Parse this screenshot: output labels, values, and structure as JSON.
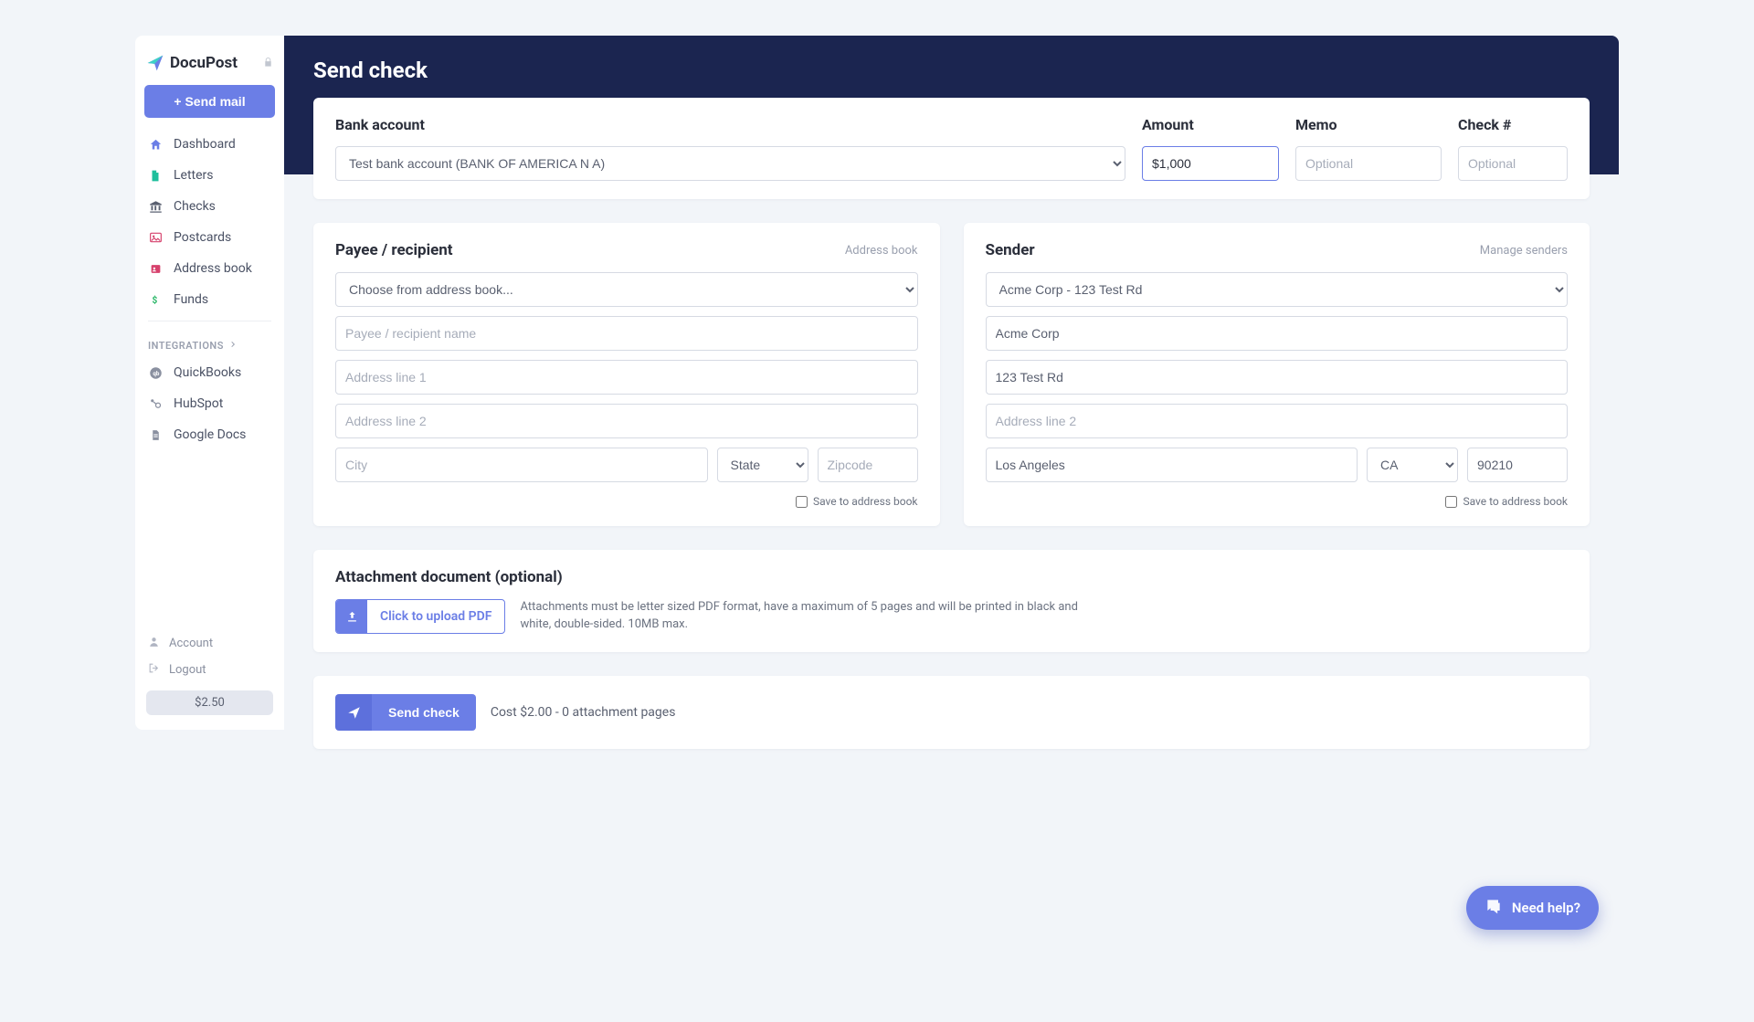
{
  "brand": {
    "name": "DocuPost"
  },
  "sidebar": {
    "send_mail_label": "+ Send mail",
    "items": [
      {
        "label": "Dashboard"
      },
      {
        "label": "Letters"
      },
      {
        "label": "Checks"
      },
      {
        "label": "Postcards"
      },
      {
        "label": "Address book"
      },
      {
        "label": "Funds"
      }
    ],
    "integrations_label": "INTEGRATIONS",
    "integrations": [
      {
        "label": "QuickBooks"
      },
      {
        "label": "HubSpot"
      },
      {
        "label": "Google Docs"
      }
    ],
    "account_label": "Account",
    "logout_label": "Logout",
    "balance": "$2.50"
  },
  "page": {
    "title": "Send check"
  },
  "bank": {
    "label": "Bank account",
    "selected": "Test bank account (BANK OF AMERICA N A)"
  },
  "amount": {
    "label": "Amount",
    "value": "$1,000"
  },
  "memo": {
    "label": "Memo",
    "placeholder": "Optional"
  },
  "check_no": {
    "label": "Check #",
    "placeholder": "Optional"
  },
  "payee": {
    "title": "Payee / recipient",
    "address_book_link": "Address book",
    "choose_placeholder": "Choose from address book...",
    "name_placeholder": "Payee / recipient name",
    "addr1_placeholder": "Address line 1",
    "addr2_placeholder": "Address line 2",
    "city_placeholder": "City",
    "state_placeholder": "State",
    "zip_placeholder": "Zipcode",
    "save_label": "Save to address book"
  },
  "sender": {
    "title": "Sender",
    "manage_link": "Manage senders",
    "selected": "Acme Corp - 123 Test Rd",
    "name": "Acme Corp",
    "addr1": "123 Test Rd",
    "addr2_placeholder": "Address line 2",
    "city": "Los Angeles",
    "state": "CA",
    "zip": "90210",
    "save_label": "Save to address book"
  },
  "attachment": {
    "title": "Attachment document (optional)",
    "upload_label": "Click to upload PDF",
    "description": "Attachments must be letter sized PDF format, have a maximum of 5 pages and will be printed in black and white, double-sided. 10MB max."
  },
  "submit": {
    "button_label": "Send check",
    "cost_text": "Cost $2.00 - 0 attachment pages"
  },
  "help": {
    "label": "Need help?"
  }
}
